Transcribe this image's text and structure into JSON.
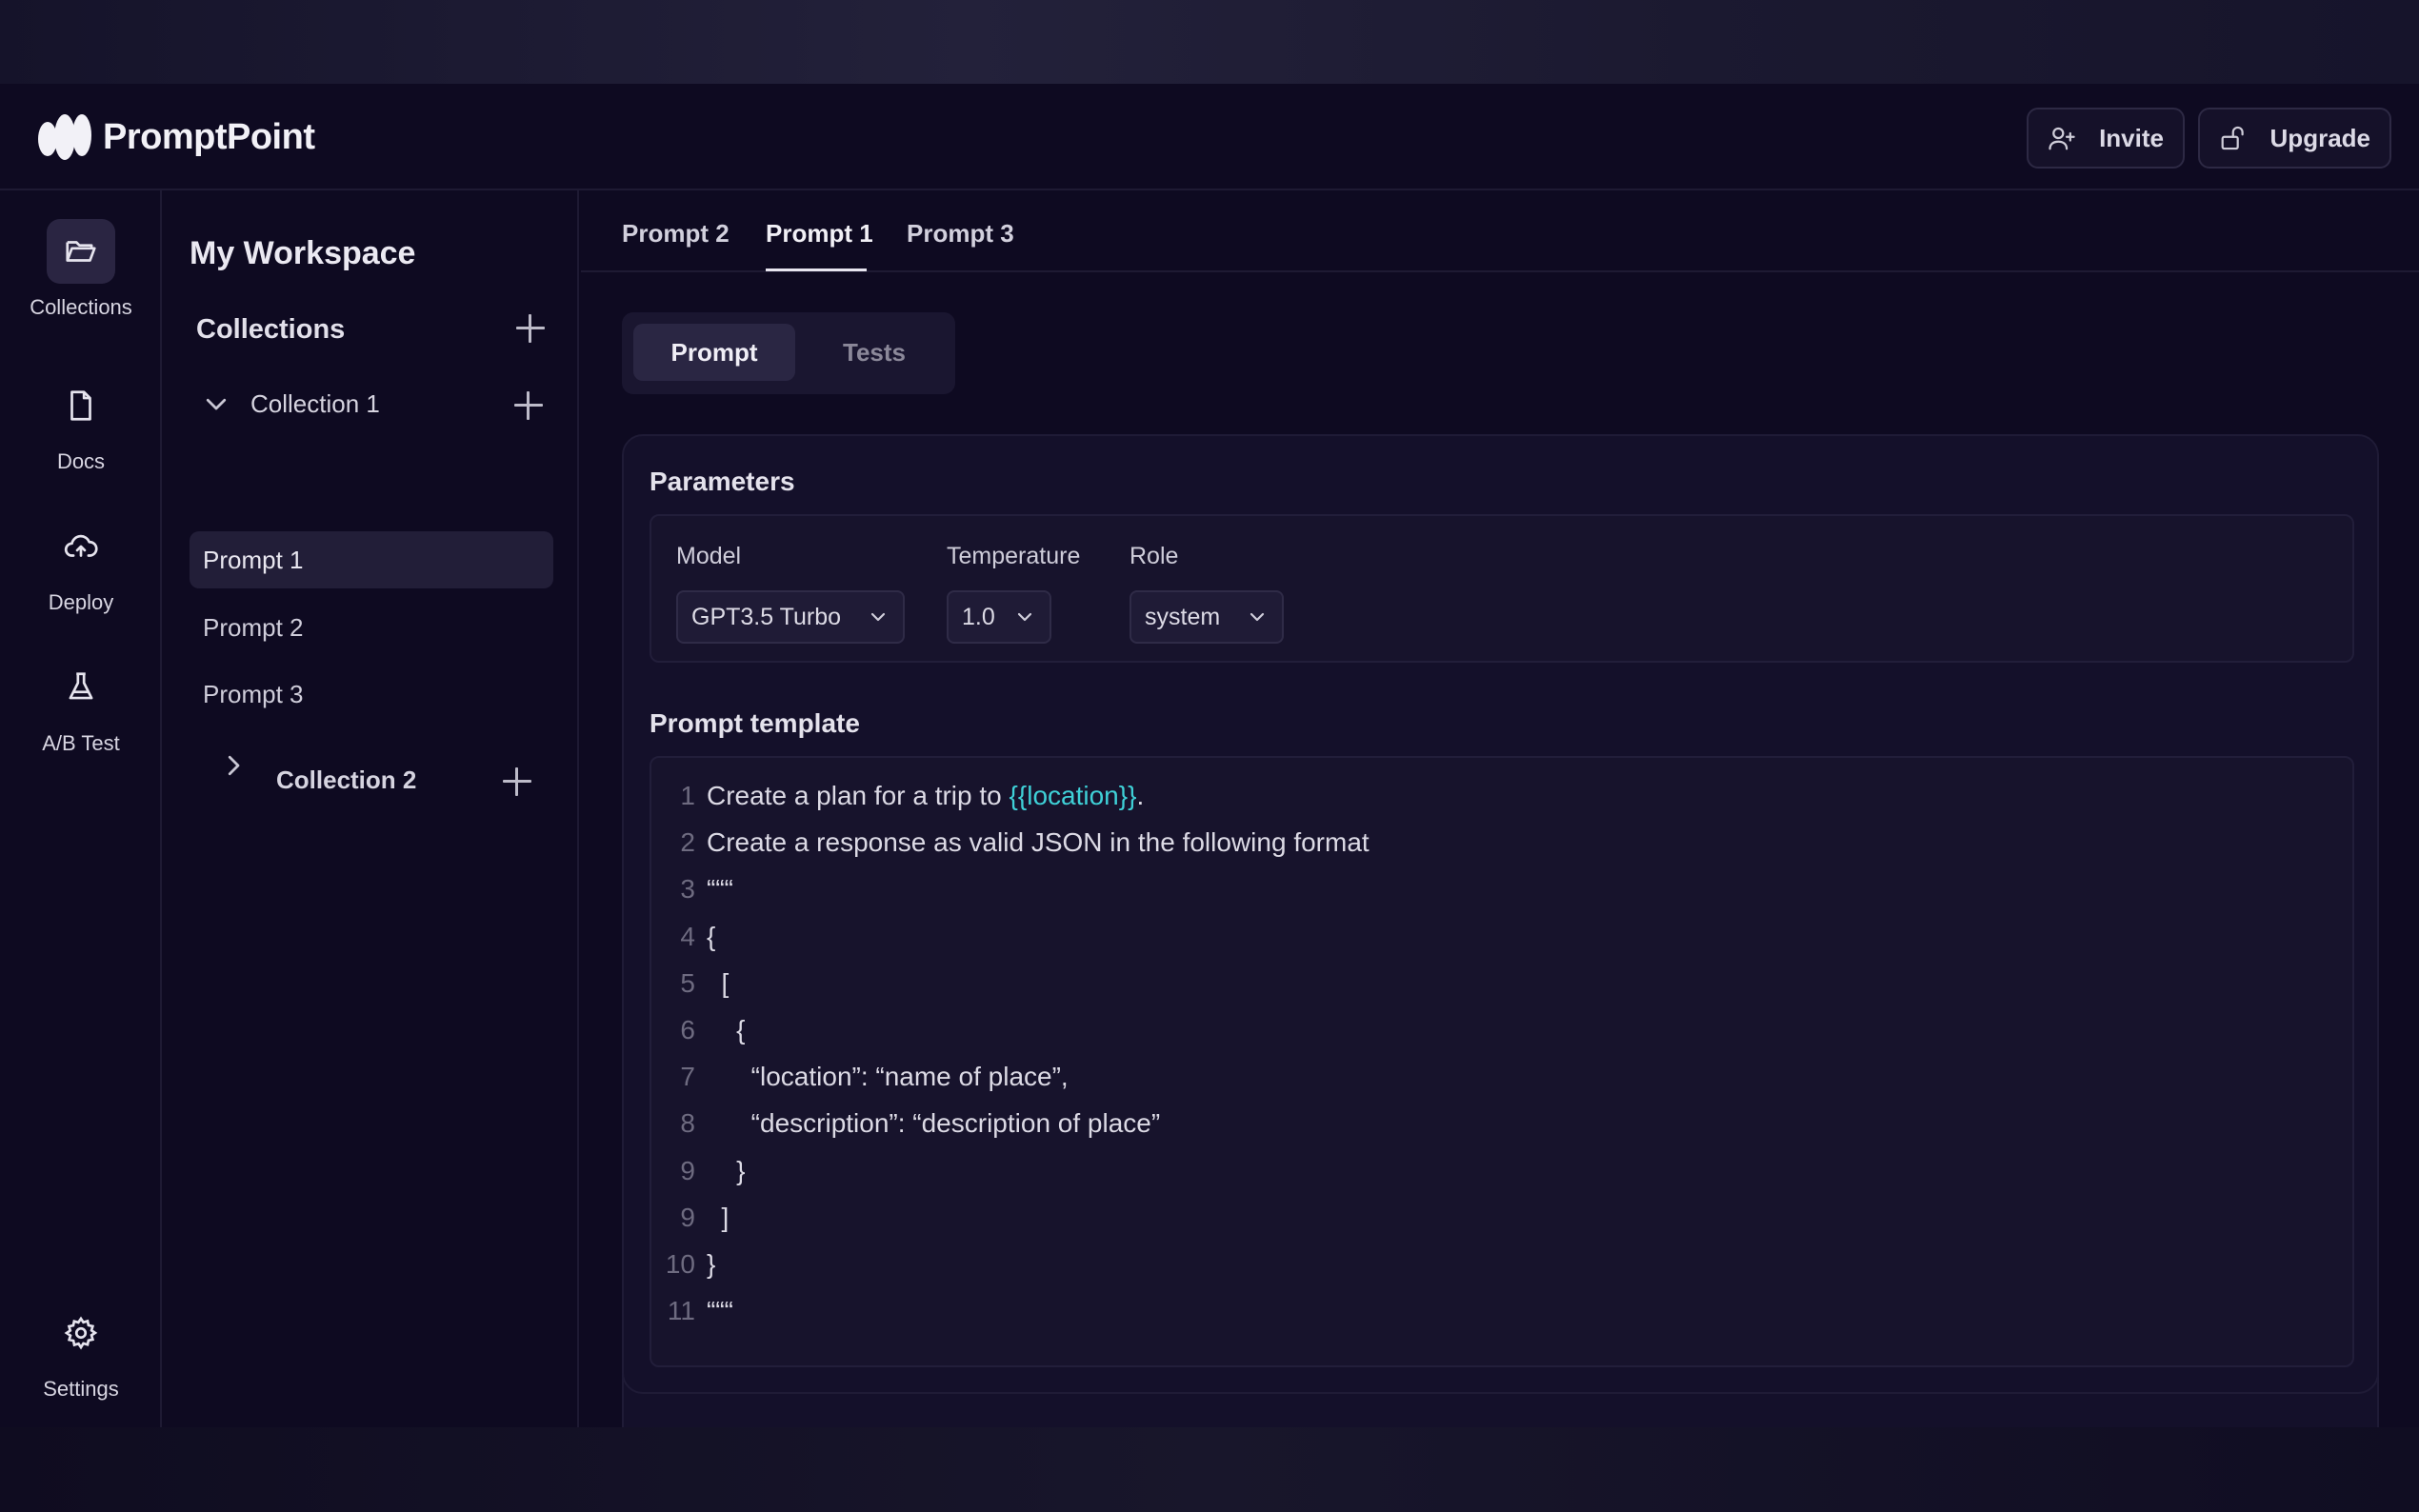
{
  "app": {
    "name": "PromptPoint"
  },
  "header": {
    "invite_label": "Invite",
    "upgrade_label": "Upgrade"
  },
  "rail": [
    {
      "label": "Collections",
      "icon": "folder-open-icon",
      "active": true
    },
    {
      "label": "Docs",
      "icon": "document-icon"
    },
    {
      "label": "Deploy",
      "icon": "cloud-upload-icon"
    },
    {
      "label": "A/B Test",
      "icon": "flask-icon"
    },
    {
      "label": "Settings",
      "icon": "gear-icon"
    }
  ],
  "sidebar": {
    "workspace_title": "My Workspace",
    "collections_heading": "Collections",
    "collection1": {
      "label": "Collection 1",
      "items": [
        "Prompt 1",
        "Prompt 2",
        "Prompt 3"
      ],
      "active_item": "Prompt 1"
    },
    "collection2": {
      "label": "Collection 2"
    }
  },
  "tabs": [
    {
      "label": "Prompt 2"
    },
    {
      "label": "Prompt 1",
      "active": true
    },
    {
      "label": "Prompt 3"
    }
  ],
  "segment": {
    "prompt": "Prompt",
    "tests": "Tests",
    "active": "Prompt"
  },
  "parameters": {
    "title": "Parameters",
    "model_label": "Model",
    "model_value": "GPT3.5 Turbo",
    "temperature_label": "Temperature",
    "temperature_value": "1.0",
    "role_label": "Role",
    "role_value": "system"
  },
  "template": {
    "title": "Prompt template",
    "lines": [
      {
        "n": "1",
        "pre": "Create a plan for a trip to ",
        "var": "{{location}}",
        "post": "."
      },
      {
        "n": "2",
        "pre": "Create a response as valid JSON in the following format"
      },
      {
        "n": "3",
        "pre": "“““"
      },
      {
        "n": "4",
        "pre": "{"
      },
      {
        "n": "5",
        "pre": "  ["
      },
      {
        "n": "6",
        "pre": "    {"
      },
      {
        "n": "7",
        "pre": "      “location”: “name of place”,"
      },
      {
        "n": "8",
        "pre": "      “description”: “description of place”"
      },
      {
        "n": "9",
        "pre": "    }"
      },
      {
        "n": "9",
        "pre": "  ]"
      },
      {
        "n": "10",
        "pre": "}"
      },
      {
        "n": "11",
        "pre": "“““"
      }
    ]
  },
  "colors": {
    "background": "#0e0a21",
    "accent_var": "#3fd0d7",
    "panel": "#14102a"
  }
}
